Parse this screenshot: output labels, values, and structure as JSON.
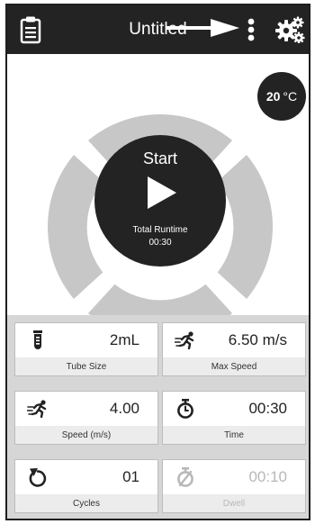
{
  "header": {
    "title": "Untitled"
  },
  "temperature": {
    "value": "20",
    "unit": "°C"
  },
  "start": {
    "label": "Start",
    "runtime_label": "Total Runtime",
    "runtime_value": "00:30"
  },
  "tiles": [
    {
      "value": "2mL",
      "label": "Tube Size",
      "icon": "test-tube-icon"
    },
    {
      "value": "6.50 m/s",
      "label": "Max Speed",
      "icon": "runner-icon"
    },
    {
      "value": "4.00",
      "label": "Speed (m/s)",
      "icon": "runner-icon"
    },
    {
      "value": "00:30",
      "label": "Time",
      "icon": "stopwatch-icon"
    },
    {
      "value": "01",
      "label": "Cycles",
      "icon": "repeat-icon"
    },
    {
      "value": "00:10",
      "label": "Dwell",
      "icon": "stopwatch-slash-icon"
    }
  ],
  "colors": {
    "dark": "#232323",
    "ring": "#c7c7c7",
    "tile_bg": "#ececec",
    "disabled": "#b8b8b8"
  }
}
